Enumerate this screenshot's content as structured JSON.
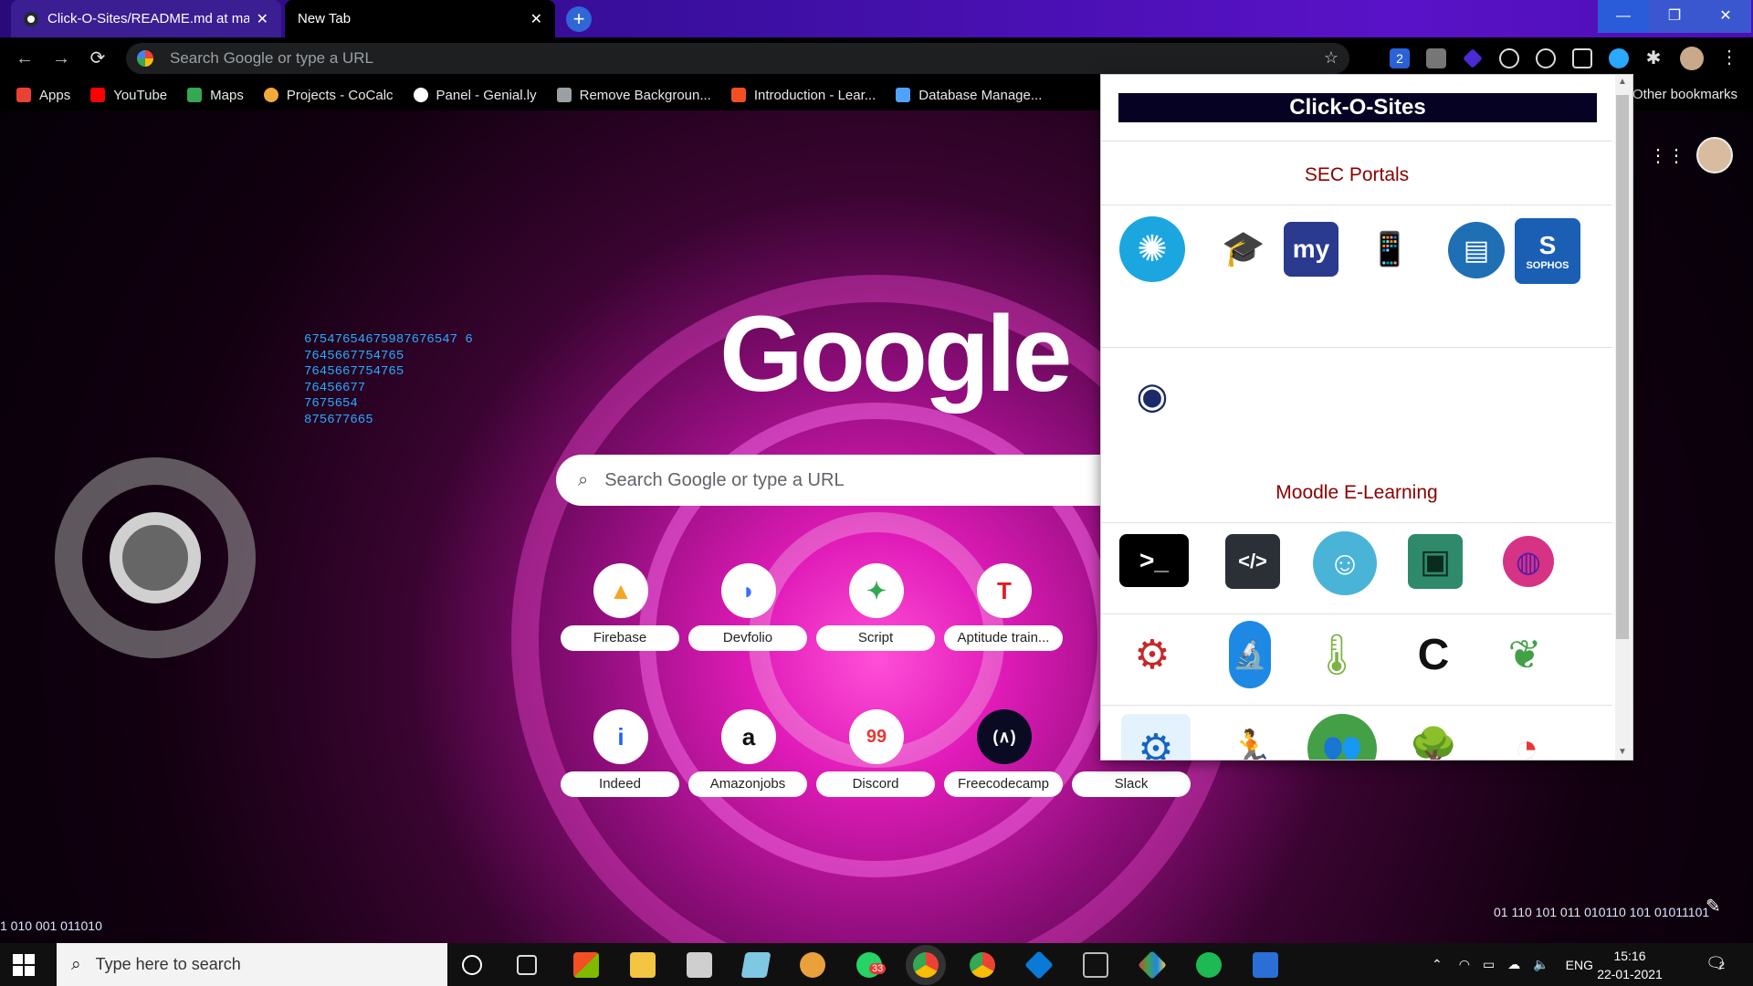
{
  "tabs": [
    {
      "title": "Click-O-Sites/README.md at ma",
      "close": "✕"
    },
    {
      "title": "New Tab",
      "close": "✕"
    }
  ],
  "new_tab_button": "+",
  "window_controls": {
    "minimize": "—",
    "maximize": "❐",
    "close": "✕"
  },
  "nav": {
    "back": "←",
    "forward": "→",
    "reload": "⟳"
  },
  "omnibox": {
    "placeholder": "Search Google or type a URL",
    "star": "☆"
  },
  "extensions": {
    "badge_number": "2",
    "menu": "⋮"
  },
  "bookmarks": [
    {
      "label": "Apps",
      "color": "#e94235"
    },
    {
      "label": "YouTube",
      "color": "#ff0000"
    },
    {
      "label": "Maps",
      "color": "#34a853"
    },
    {
      "label": "Projects - CoCalc",
      "color": "#f2a93b"
    },
    {
      "label": "Panel - Genial.ly",
      "color": "#ffffff"
    },
    {
      "label": "Remove Backgroun...",
      "color": "#9aa0a6"
    },
    {
      "label": "Introduction - Lear...",
      "color": "#f25022"
    },
    {
      "label": "Database Manage...",
      "color": "#4fa3ff"
    }
  ],
  "other_bookmarks": "Other bookmarks",
  "ntp": {
    "binary_lines": [
      "67547654675987676547⁠ 6",
      "7645667754765",
      "7645667754765",
      "76456677",
      "7675654",
      "875677665"
    ],
    "binary_bottom": "01  110  101  011  010110  101  01011101",
    "binary_left": "1   010   001   011010",
    "logo": "Google",
    "search_placeholder": "Search Google or type a URL",
    "search_icon": "⌕",
    "apps_icon": "⋮⋮⋮",
    "edit_icon": "✎",
    "shortcuts": [
      {
        "label": "Firebase",
        "glyph": "▲",
        "color": "#f5a623"
      },
      {
        "label": "Devfolio",
        "glyph": "◗",
        "color": "#3770ff"
      },
      {
        "label": "Script",
        "glyph": "✦",
        "color": "#34a853"
      },
      {
        "label": "Aptitude train...",
        "glyph": "T",
        "color": "#e31b23"
      },
      {
        "label": "Indeed",
        "glyph": "i",
        "color": "#2164f3"
      },
      {
        "label": "Amazonjobs",
        "glyph": "a",
        "color": "#111111"
      },
      {
        "label": "Discord",
        "glyph": "99",
        "color": "#e53935"
      },
      {
        "label": "Freecodecamp",
        "glyph": "(∧)",
        "color": "#0a0a23"
      },
      {
        "label": "Slack",
        "glyph": "",
        "color": "#ffffff"
      }
    ]
  },
  "popup": {
    "title": "Click-O-Sites",
    "section1": "SEC Portals",
    "section2": "Moodle E-Learning",
    "sec_icons": [
      {
        "name": "college-seal",
        "glyph": "✺",
        "bg": "#1ba6e0",
        "fg": "#ffffff"
      },
      {
        "name": "graduation-cap",
        "glyph": "🎓",
        "bg": "#ffffff",
        "fg": "#111111"
      },
      {
        "name": "mycomu",
        "glyph": "my",
        "bg": "#2a3a8f",
        "fg": "#ffffff"
      },
      {
        "name": "phone-app",
        "glyph": "📱",
        "bg": "#ffffff",
        "fg": "#c23b8a"
      },
      {
        "name": "server",
        "glyph": "▤",
        "bg": "#1f6fb5",
        "fg": "#ffffff"
      },
      {
        "name": "sophos",
        "glyph": "S",
        "bg": "#1a5fb4",
        "fg": "#ffffff"
      },
      {
        "name": "webcam",
        "glyph": "◉",
        "bg": "#ffffff",
        "fg": "#1a2a6a"
      }
    ],
    "sophos_label": "SOPHOS",
    "moodle_row1": [
      {
        "name": "terminal",
        "glyph": ">_",
        "bg": "#000000",
        "fg": "#ffffff"
      },
      {
        "name": "code",
        "glyph": "</>",
        "bg": "#2b2f36",
        "fg": "#ffffff"
      },
      {
        "name": "brain",
        "glyph": "☺",
        "bg": "#4ab3d8",
        "fg": "#ffffff"
      },
      {
        "name": "chip",
        "glyph": "▣",
        "bg": "#2e8a6a",
        "fg": "#0b2b1e"
      },
      {
        "name": "circuit",
        "glyph": "◍",
        "bg": "#d63384",
        "fg": "#5a1aa8"
      }
    ],
    "moodle_row2": [
      {
        "name": "gears",
        "glyph": "⚙",
        "bg": "#ffffff",
        "fg": "#c62828"
      },
      {
        "name": "microscope",
        "glyph": "🔬",
        "bg": "#1e88e5",
        "fg": "#ffffff"
      },
      {
        "name": "thermometer",
        "glyph": "🌡",
        "bg": "#ffffff",
        "fg": "#7cb342"
      },
      {
        "name": "robot-arm",
        "glyph": "C",
        "bg": "#ffffff",
        "fg": "#111111"
      },
      {
        "name": "plant",
        "glyph": "❦",
        "bg": "#ffffff",
        "fg": "#43a047"
      }
    ],
    "moodle_row3": [
      {
        "name": "settings",
        "glyph": "⚙",
        "bg": "#e3f2fd",
        "fg": "#1565c0"
      },
      {
        "name": "runner",
        "glyph": "🏃",
        "bg": "#ffffff",
        "fg": "#b71c1c"
      },
      {
        "name": "team",
        "glyph": "👥",
        "bg": "#43a047",
        "fg": "#ffffff"
      },
      {
        "name": "tree",
        "glyph": "🌳",
        "bg": "#ffffff",
        "fg": "#8e24aa"
      },
      {
        "name": "swirl",
        "glyph": "◔",
        "bg": "#ffffff",
        "fg": "#e53935"
      }
    ]
  },
  "taskbar": {
    "search_placeholder": "Type here to search",
    "whatsapp_badge": "33",
    "language": "ENG",
    "time": "15:16",
    "date": "22-01-2021",
    "notif_count": "2"
  }
}
